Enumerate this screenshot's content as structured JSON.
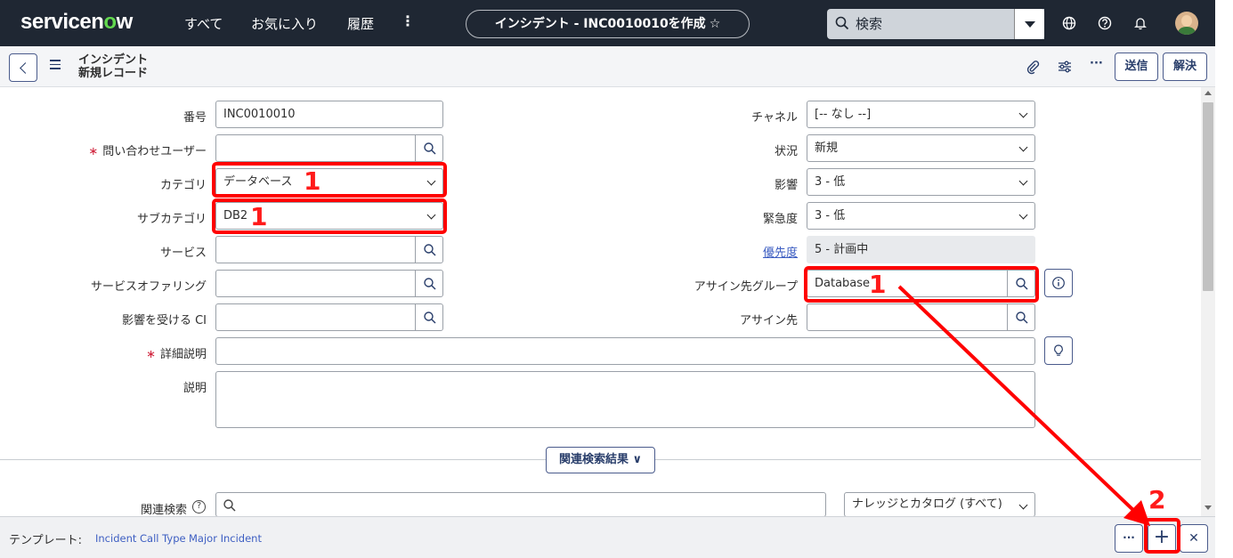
{
  "nav": {
    "logo_pre": "servicen",
    "logo_o": "o",
    "logo_post": "w",
    "all": "すべて",
    "favorites": "お気に入り",
    "history": "履歴",
    "more": "⋮",
    "page_title": "インシデント - INC0010010を作成",
    "star": "☆",
    "search_placeholder": "検索"
  },
  "header": {
    "line1": "インシデント",
    "line2": "新規レコード",
    "submit": "送信",
    "resolve": "解決",
    "more": "···"
  },
  "form": {
    "number": {
      "label": "番号",
      "value": "INC0010010"
    },
    "caller": {
      "required": "∗",
      "label": "問い合わせユーザー",
      "value": ""
    },
    "category": {
      "label": "カテゴリ",
      "value": "データベース"
    },
    "subcategory": {
      "label": "サブカテゴリ",
      "value": "DB2"
    },
    "service": {
      "label": "サービス",
      "value": ""
    },
    "service_offering": {
      "label": "サービスオファリング",
      "value": ""
    },
    "affected_ci": {
      "label": "影響を受ける CI",
      "value": ""
    },
    "short_description": {
      "required": "∗",
      "label": "詳細説明",
      "value": ""
    },
    "description": {
      "label": "説明",
      "value": ""
    },
    "channel": {
      "label": "チャネル",
      "value": "[-- なし --]"
    },
    "state": {
      "label": "状況",
      "value": "新規"
    },
    "impact": {
      "label": "影響",
      "value": "3 - 低"
    },
    "urgency": {
      "label": "緊急度",
      "value": "3 - 低"
    },
    "priority": {
      "label": "優先度",
      "value": "5 - 計画中"
    },
    "assignment_group": {
      "label": "アサイン先グループ",
      "value": "Database"
    },
    "assigned_to": {
      "label": "アサイン先",
      "value": ""
    }
  },
  "related": {
    "button": "関連検索結果 ∨",
    "label": "関連検索",
    "help": "?",
    "scope": "ナレッジとカタログ (すべて)"
  },
  "template_bar": {
    "label": "テンプレート:",
    "links": [
      "Incident Call Type",
      "Major Incident"
    ],
    "more": "···",
    "add": "+",
    "close": "✕"
  },
  "annotations": {
    "category": "1",
    "subcategory": "1",
    "assignment_group": "1",
    "add_template": "2"
  },
  "colors": {
    "annotation": "#ff0000",
    "nav_bg": "#1f2733",
    "logo_o": "#62d84e",
    "link": "#3d5ec2",
    "button_text": "#293e6b"
  }
}
